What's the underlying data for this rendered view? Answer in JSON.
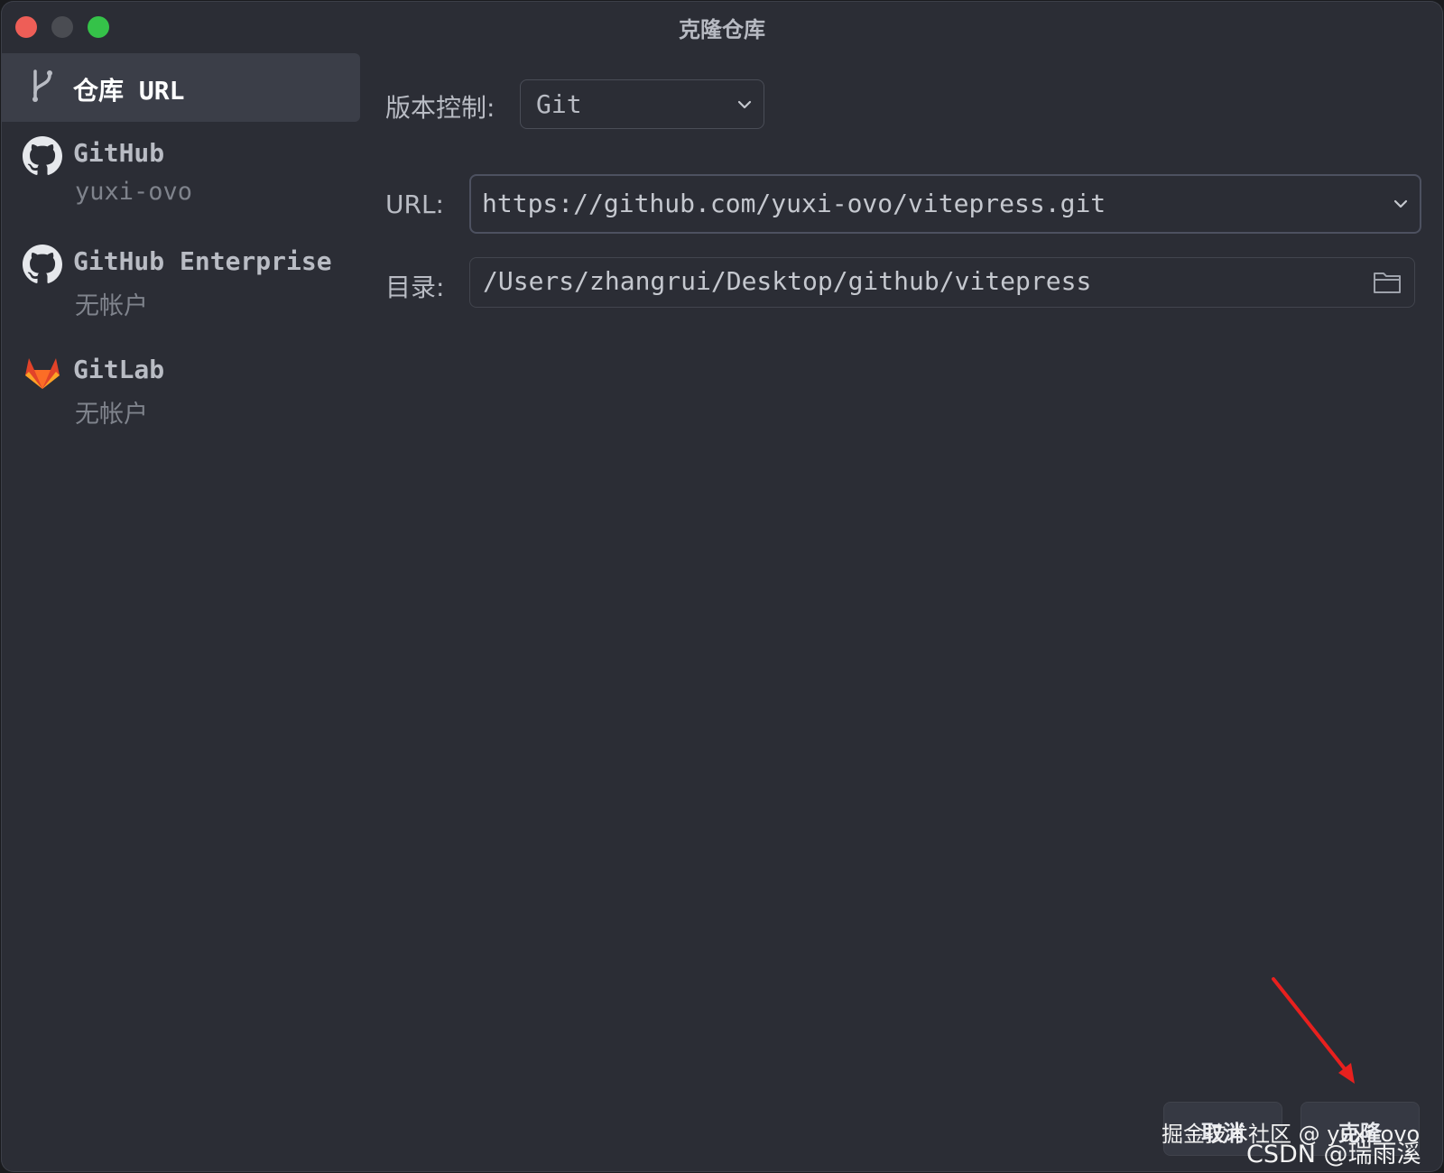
{
  "window": {
    "title": "克隆仓库"
  },
  "sidebar": {
    "items": [
      {
        "label": "仓库 URL",
        "sub": "",
        "icon": "vcs-branch-icon",
        "active": true
      },
      {
        "label": "GitHub",
        "sub": "yuxi-ovo",
        "icon": "github-icon",
        "active": false
      },
      {
        "label": "GitHub Enterprise",
        "sub": "无帐户",
        "icon": "github-icon",
        "active": false
      },
      {
        "label": "GitLab",
        "sub": "无帐户",
        "icon": "gitlab-icon",
        "active": false
      }
    ]
  },
  "form": {
    "vcs_label": "版本控制:",
    "vcs_value": "Git",
    "url_label": "URL:",
    "url_value": "https://github.com/yuxi-ovo/vitepress.git",
    "dir_label": "目录:",
    "dir_value": "/Users/zhangrui/Desktop/github/vitepress"
  },
  "buttons": {
    "cancel": "取消",
    "clone": "克隆"
  },
  "annotation": {
    "arrow_color": "#e8201e"
  },
  "watermark": {
    "line1": "掘金技术社区 @ yuxi-ovo",
    "line2": "CSDN @瑞雨溪"
  },
  "colors": {
    "background": "#2b2d35",
    "active_item": "#3b3e48",
    "close": "#ee5e57",
    "maximize": "#35c249"
  }
}
